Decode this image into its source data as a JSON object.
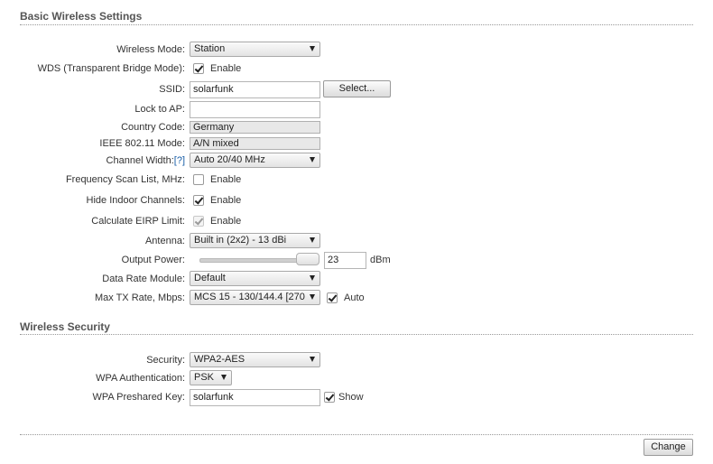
{
  "basic": {
    "title": "Basic Wireless Settings",
    "wireless_mode": {
      "label": "Wireless Mode:",
      "value": "Station"
    },
    "wds": {
      "label": "WDS (Transparent Bridge Mode):",
      "checked": true,
      "text": "Enable"
    },
    "ssid": {
      "label": "SSID:",
      "value": "solarfunk",
      "button": "Select..."
    },
    "lock_ap": {
      "label": "Lock to AP:",
      "value": ""
    },
    "country": {
      "label": "Country Code:",
      "value": "Germany"
    },
    "ieee": {
      "label": "IEEE 802.11 Mode:",
      "value": "A/N mixed"
    },
    "channel_width": {
      "label": "Channel Width:",
      "help": "[?]",
      "value": "Auto 20/40 MHz"
    },
    "freq_scan": {
      "label": "Frequency Scan List, MHz:",
      "checked": false,
      "text": "Enable"
    },
    "hide_indoor": {
      "label": "Hide Indoor Channels:",
      "checked": true,
      "text": "Enable"
    },
    "eirp": {
      "label": "Calculate EIRP Limit:",
      "checked": true,
      "disabled": true,
      "text": "Enable"
    },
    "antenna": {
      "label": "Antenna:",
      "value": "Built in (2x2) - 13 dBi"
    },
    "output_power": {
      "label": "Output Power:",
      "value": "23",
      "unit": "dBm",
      "slider_fraction": 1.0
    },
    "data_rate": {
      "label": "Data Rate Module:",
      "value": "Default"
    },
    "max_tx": {
      "label": "Max TX Rate, Mbps:",
      "value": "MCS 15 - 130/144.4 [270",
      "auto_checked": true,
      "auto_text": "Auto"
    }
  },
  "security": {
    "title": "Wireless Security",
    "security": {
      "label": "Security:",
      "value": "WPA2-AES"
    },
    "wpa_auth": {
      "label": "WPA Authentication:",
      "value": "PSK"
    },
    "psk": {
      "label": "WPA Preshared Key:",
      "value": "solarfunk",
      "show_checked": true,
      "show_text": "Show"
    }
  },
  "footer": {
    "change_button": "Change"
  },
  "colors": {
    "help_link": "#1a5fa8",
    "section_title": "#555555"
  }
}
